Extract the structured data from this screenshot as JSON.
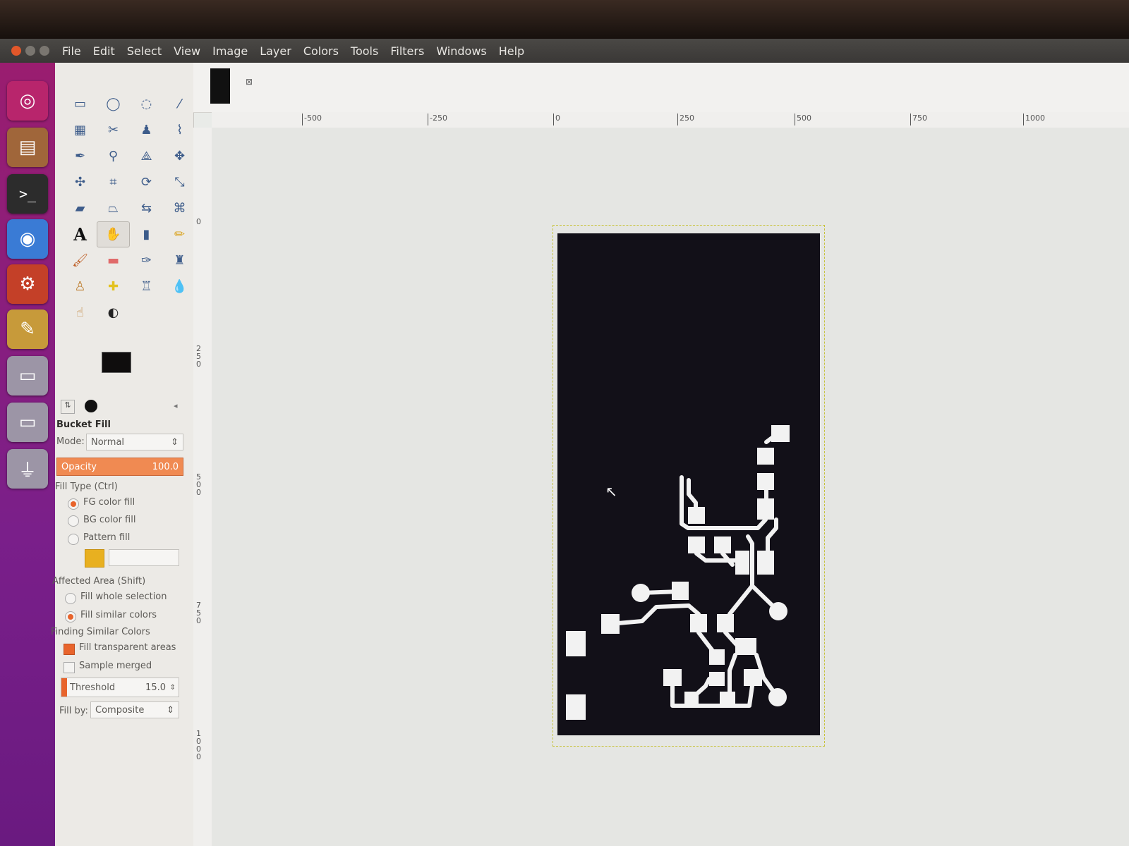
{
  "menubar": {
    "items": [
      "File",
      "Edit",
      "Select",
      "View",
      "Image",
      "Layer",
      "Colors",
      "Tools",
      "Filters",
      "Windows",
      "Help"
    ]
  },
  "launcher": {
    "icons": [
      "ubuntu-dash-icon",
      "files-icon",
      "terminal-icon",
      "chromium-icon",
      "settings-icon",
      "gimp-icon",
      "drive-icon",
      "drive-icon",
      "usb-icon"
    ]
  },
  "toolbox": {
    "tools": [
      "rect-select",
      "ellipse-select",
      "free-select",
      "fuzzy-select",
      "color-select",
      "scissors",
      "foreground-select",
      "paths",
      "color-picker",
      "zoom",
      "measure",
      "move",
      "align",
      "crop",
      "rotate",
      "scale",
      "shear",
      "perspective",
      "flip",
      "cage",
      "text",
      "bucket-fill",
      "blend",
      "pencil",
      "paintbrush",
      "eraser",
      "airbrush",
      "ink",
      "clone",
      "heal",
      "perspective-clone",
      "blur",
      "smudge",
      "dodge-burn"
    ],
    "active_tool": "bucket-fill",
    "fg_color": "#0f0d0d",
    "bg_color": "#ffffff",
    "options": {
      "title": "Bucket Fill",
      "mode_label": "Mode:",
      "mode_value": "Normal",
      "opacity_label": "Opacity",
      "opacity_value": "100.0",
      "fill_type_label": "Fill Type  (Ctrl)",
      "fg_fill": "FG color fill",
      "bg_fill": "BG color fill",
      "pattern_fill": "Pattern fill",
      "affected_area_label": "Affected Area  (Shift)",
      "fill_whole": "Fill whole selection",
      "fill_similar": "Fill similar colors",
      "finding_label": "Finding Similar Colors",
      "fill_transparent": "Fill transparent areas",
      "sample_merged": "Sample merged",
      "threshold_label": "Threshold",
      "threshold_value": "15.0",
      "fill_by_label": "Fill by:",
      "fill_by_value": "Composite"
    }
  },
  "rulers": {
    "horizontal": [
      "-500",
      "-250",
      "0",
      "250",
      "500",
      "750",
      "1000"
    ],
    "vertical": [
      "0",
      "250",
      "500",
      "750",
      "1000"
    ]
  },
  "accent": "#e8642c"
}
